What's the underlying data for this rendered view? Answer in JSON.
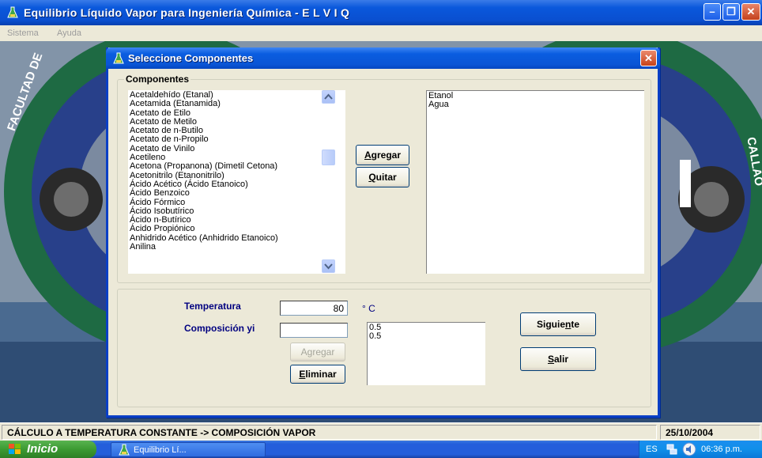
{
  "main_window": {
    "title": "Equilibrio Líquido Vapor para Ingeniería Química - E L V I Q",
    "icon": "flask-icon",
    "controls": [
      "minimize-icon",
      "restore-icon",
      "close-icon"
    ]
  },
  "menubar": {
    "items": [
      "Sistema",
      "Ayuda"
    ]
  },
  "background": {
    "left_emblem_text": "FACULTAD DE",
    "right_emblem_text": "CALLAO",
    "colors": {
      "sky": "#7d8fa2",
      "emblem_green": "#1f6e45",
      "emblem_blue": "#243c8a"
    }
  },
  "dialog": {
    "title": "Seleccione Componentes",
    "components_group": {
      "legend": "Componentes",
      "available_list": [
        "Acetaldehído (Etanal)",
        "Acetamida (Etanamida)",
        "Acetato de Etilo",
        "Acetato de Metilo",
        "Acetato de n-Butilo",
        "Acetato de n-Propilo",
        "Acetato de Vinilo",
        "Acetileno",
        "Acetona (Propanona) (Dimetil Cetona)",
        "Acetonitrilo (Etanonitrilo)",
        "Ácido Acético (Ácido Etanoico)",
        "Ácido Benzoico",
        "Ácido Fórmico",
        "Ácido Isobutírico",
        "Ácido n-Butírico",
        "Ácido Propiónico",
        "Anhidrido Acético (Anhidrido Etanoico)",
        "Anilina"
      ],
      "add_button": "Agregar",
      "remove_button": "Quitar",
      "selected_list": [
        "Etanol",
        "Agua"
      ]
    },
    "conditions_group": {
      "temperature_label": "Temperatura",
      "temperature_value": "80",
      "temperature_unit": "° C",
      "composition_label": "Composición yi",
      "composition_value": "",
      "add_button": "Agregar",
      "delete_button": "Eliminar",
      "composition_list": [
        "0.5",
        "0.5"
      ],
      "next_button": "Siguiente",
      "exit_button": "Salir"
    }
  },
  "statusbar": {
    "mode": "CÁLCULO A TEMPERATURA CONSTANTE -> COMPOSICIÓN VAPOR",
    "date": "25/10/2004"
  },
  "taskbar": {
    "start_label": "Inicio",
    "task_label": "Equilibrio Lí...",
    "language": "ES",
    "clock": "06:36 p.m."
  }
}
